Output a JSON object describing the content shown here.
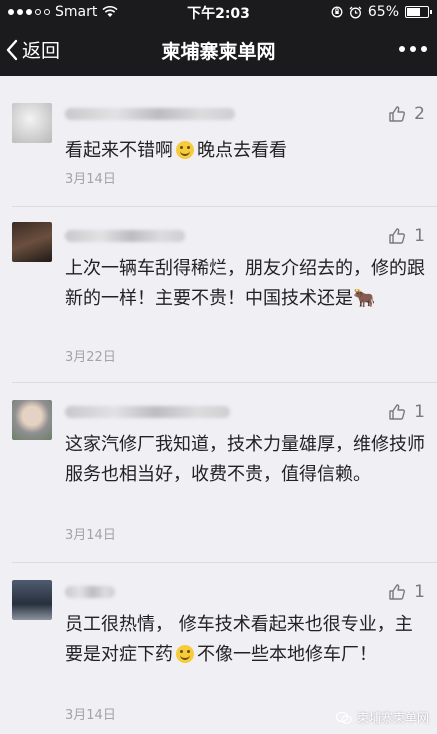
{
  "status_bar": {
    "carrier": "Smart",
    "time": "下午2:03",
    "battery": "65%",
    "battery_level": 0.65
  },
  "nav": {
    "back_label": "返回",
    "title": "柬埔寨柬单网"
  },
  "comments": [
    {
      "text_a": "看起来不错啊",
      "text_b": "晚点去看看",
      "date": "3月14日",
      "likes": "2"
    },
    {
      "text": "上次一辆车刮得稀烂，朋友介绍去的，修的跟新的一样！主要不贵！中国技术还是🐂",
      "date": "3月22日",
      "likes": "1"
    },
    {
      "text": "这家汽修厂我知道，技术力量雄厚，维修技师服务也相当好，收费不贵，值得信赖。",
      "date": "3月14日",
      "likes": "1"
    },
    {
      "text_a": "员工很热情， 修车技术看起来也很专业，主要是对症下药",
      "text_b": "不像一些本地修车厂！",
      "date": "3月14日",
      "likes": "1"
    }
  ],
  "watermark": "柬埔寨柬单网"
}
